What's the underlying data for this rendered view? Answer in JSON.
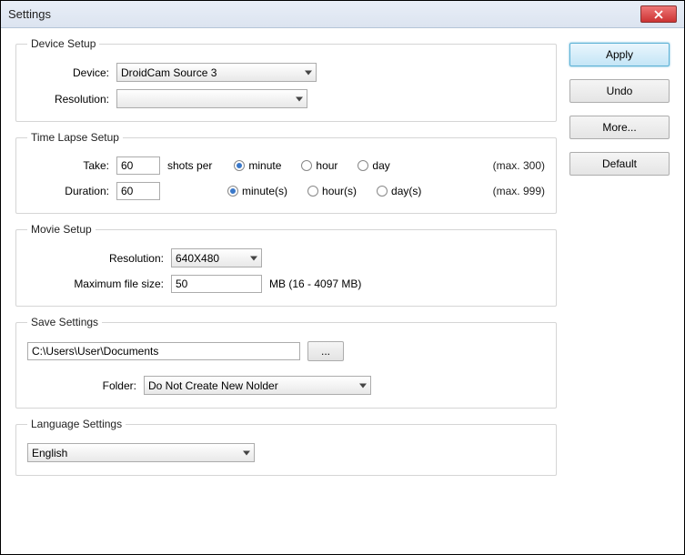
{
  "title": "Settings",
  "buttons": {
    "apply": "Apply",
    "undo": "Undo",
    "more": "More...",
    "default": "Default"
  },
  "device": {
    "legend": "Device Setup",
    "device_label": "Device:",
    "device_value": "DroidCam Source 3",
    "resolution_label": "Resolution:",
    "resolution_value": ""
  },
  "timelapse": {
    "legend": "Time Lapse Setup",
    "take_label": "Take:",
    "take_value": "60",
    "shots_per": "shots per",
    "take_options": {
      "minute": "minute",
      "hour": "hour",
      "day": "day"
    },
    "take_max": "(max. 300)",
    "duration_label": "Duration:",
    "duration_value": "60",
    "duration_options": {
      "minutes": "minute(s)",
      "hours": "hour(s)",
      "days": "day(s)"
    },
    "duration_max": "(max. 999)"
  },
  "movie": {
    "legend": "Movie Setup",
    "resolution_label": "Resolution:",
    "resolution_value": "640X480",
    "maxsize_label": "Maximum file size:",
    "maxsize_value": "50",
    "maxsize_hint": "MB (16 - 4097 MB)"
  },
  "save": {
    "legend": "Save Settings",
    "path": "C:\\Users\\User\\Documents",
    "browse": "...",
    "folder_label": "Folder:",
    "folder_value": "Do Not Create New Nolder"
  },
  "lang": {
    "legend": "Language Settings",
    "value": "English"
  }
}
